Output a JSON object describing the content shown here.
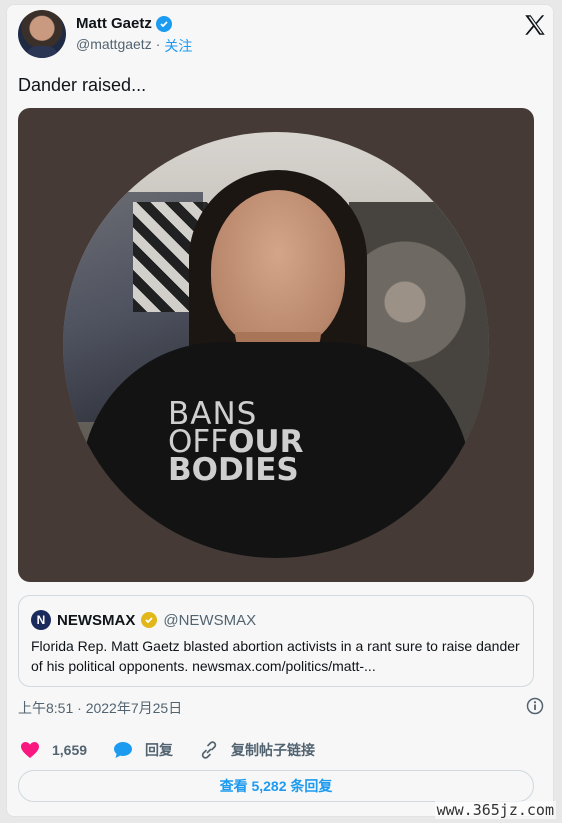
{
  "author": {
    "display_name": "Matt Gaetz",
    "handle": "@mattgaetz",
    "separator": "·",
    "follow_label": "关注"
  },
  "tweet": {
    "text": "Dander raised...",
    "shirt_text": {
      "line1": "BANS",
      "line2_a": "OFF",
      "line2_b": "OUR",
      "line3": "BODIES"
    }
  },
  "quoted": {
    "logo_letter": "N",
    "name": "NEWSMAX",
    "handle": "@NEWSMAX",
    "text": "Florida Rep. Matt Gaetz blasted abortion activists in a rant sure to raise dander of his political opponents.  newsmax.com/politics/matt-..."
  },
  "timestamp": "上午8:51 · 2022年7月25日",
  "actions": {
    "likes": "1,659",
    "reply_label": "回复",
    "copy_link_label": "复制帖子链接"
  },
  "replies_button": "查看 5,282 条回复",
  "watermark": "www.365jz.com",
  "colors": {
    "accent": "#1d9bf0",
    "like": "#f91880",
    "verified_gold": "#e2b719"
  }
}
